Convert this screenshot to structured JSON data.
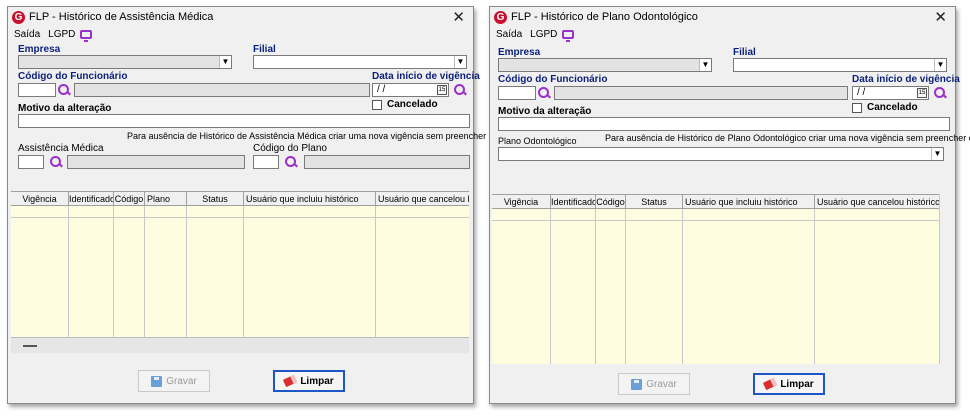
{
  "medical": {
    "title": "FLP - Histórico de Assistência Médica",
    "menu": {
      "exit": "Saída",
      "lgpd": "LGPD"
    },
    "labels": {
      "empresa": "Empresa",
      "filial": "Filial",
      "codigo_funcionario": "Código do Funcionário",
      "data_inicio": "Data início de vigência",
      "cancelado": "Cancelado",
      "motivo": "Motivo da alteração",
      "hint": "Para ausência de Histórico de Assistência Médica criar uma nova vigência sem preencher o código",
      "assistencia": "Assistência Médica",
      "codigo_plano": "Código do Plano"
    },
    "date_value": "/ /",
    "columns": [
      "Vigência",
      "Identificador",
      "Código",
      "Plano",
      "Status",
      "Usuário que incluiu histórico",
      "Usuário que cancelou histó"
    ],
    "buttons": {
      "save": "Gravar",
      "clear": "Limpar"
    }
  },
  "dental": {
    "title": "FLP - Histórico de Plano Odontológico",
    "menu": {
      "exit": "Saída",
      "lgpd": "LGPD"
    },
    "labels": {
      "empresa": "Empresa",
      "filial": "Filial",
      "codigo_funcionario": "Código do Funcionário",
      "data_inicio": "Data início de vigência",
      "cancelado": "Cancelado",
      "motivo": "Motivo da alteração",
      "plano": "Plano Odontológico",
      "hint": "Para ausência de Histórico de Plano Odontológico criar uma nova vigência sem preencher o código"
    },
    "date_value": "/ /",
    "columns": [
      "Vigência",
      "Identificador",
      "Código",
      "Status",
      "Usuário que incluiu histórico",
      "Usuário que cancelou histórico"
    ],
    "buttons": {
      "save": "Gravar",
      "clear": "Limpar"
    }
  },
  "colors": {
    "accent": "#9b2fc9",
    "grid_bg": "#fffde0",
    "label_navy": "#0a1f7a",
    "focus_border": "#1e56c7"
  },
  "icons": {
    "logo": "flp-logo",
    "close": "close-icon",
    "lgpd": "monitor-icon",
    "lookup": "search-icon",
    "calendar": "calendar-icon",
    "save": "save-icon",
    "clear": "eraser-icon"
  }
}
